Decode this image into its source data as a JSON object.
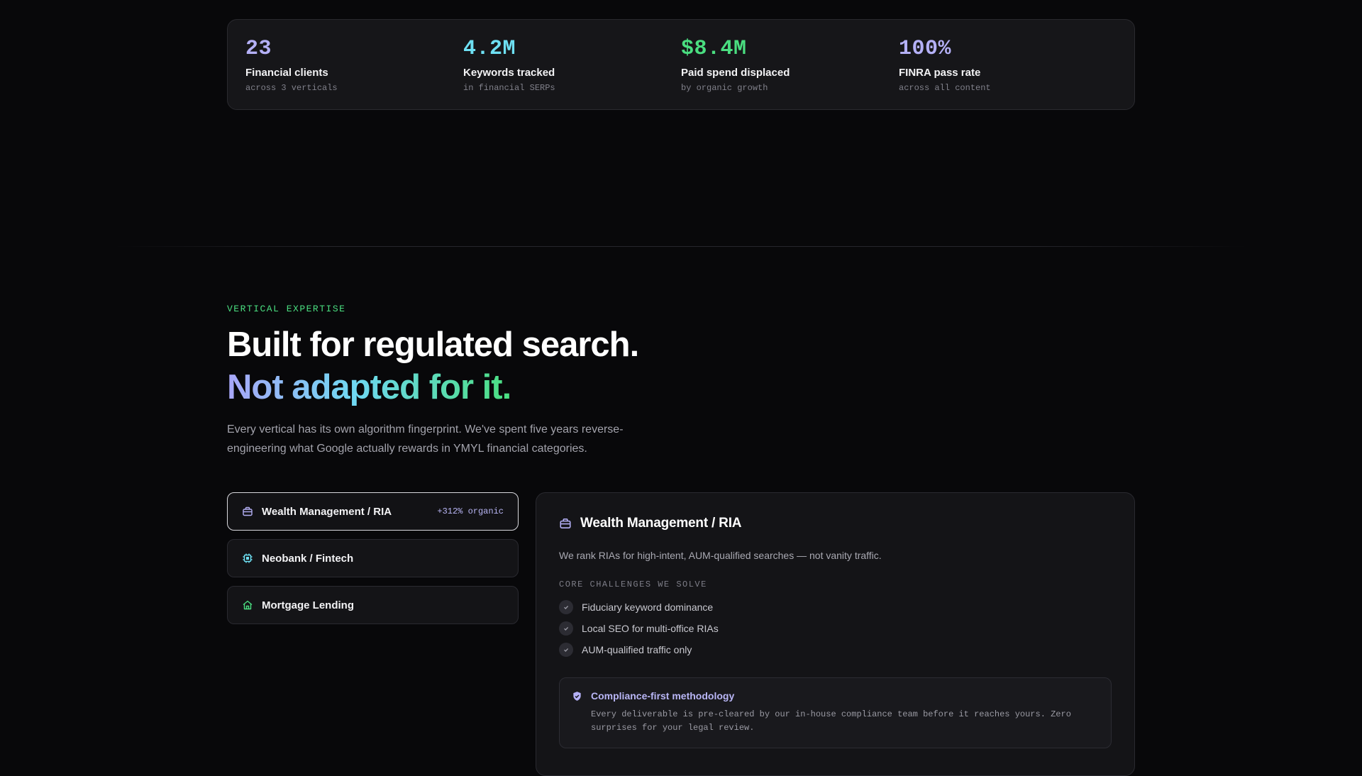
{
  "stats": [
    {
      "value": "23",
      "label": "Financial clients",
      "sub": "across 3 verticals",
      "color": "#b4b0f6"
    },
    {
      "value": "4.2M",
      "label": "Keywords tracked",
      "sub": "in financial SERPs",
      "color": "#6ee0f3"
    },
    {
      "value": "$8.4M",
      "label": "Paid spend displaced",
      "sub": "by organic growth",
      "color": "#4ade80"
    },
    {
      "value": "100%",
      "label": "FINRA pass rate",
      "sub": "across all content",
      "color": "#b4b0f6"
    }
  ],
  "section": {
    "eyebrow": "VERTICAL EXPERTISE",
    "headline_line1": "Built for regulated search.",
    "headline_line2": "Not adapted for it.",
    "lede": "Every vertical has its own algorithm fingerprint. We've spent five years reverse-engineering what Google actually rewards in YMYL financial categories."
  },
  "tabs": [
    {
      "label": "Wealth Management / RIA",
      "badge": "+312% organic",
      "icon": "briefcase-icon",
      "icon_color": "#b4b0f6",
      "active": true
    },
    {
      "label": "Neobank / Fintech",
      "badge": "",
      "icon": "chip-icon",
      "icon_color": "#6ee0f3",
      "active": false
    },
    {
      "label": "Mortgage Lending",
      "badge": "",
      "icon": "house-icon",
      "icon_color": "#4ade80",
      "active": false
    }
  ],
  "detail": {
    "title": "Wealth Management / RIA",
    "icon": "briefcase-icon",
    "description": "We rank RIAs for high-intent, AUM-qualified searches — not vanity traffic.",
    "kicker": "CORE CHALLENGES WE SOLVE",
    "challenges": [
      "Fiduciary keyword dominance",
      "Local SEO for multi-office RIAs",
      "AUM-qualified traffic only"
    ],
    "callout": {
      "icon": "shield-check-icon",
      "title": "Compliance-first methodology",
      "body": "Every deliverable is pre-cleared by our in-house compliance team before it reaches yours. Zero surprises for your legal review."
    }
  },
  "colors": {
    "accent_violet": "#b4b0f6",
    "accent_cyan": "#6ee0f3",
    "accent_green": "#4ade80",
    "background": "#08080a",
    "card": "#161619"
  }
}
